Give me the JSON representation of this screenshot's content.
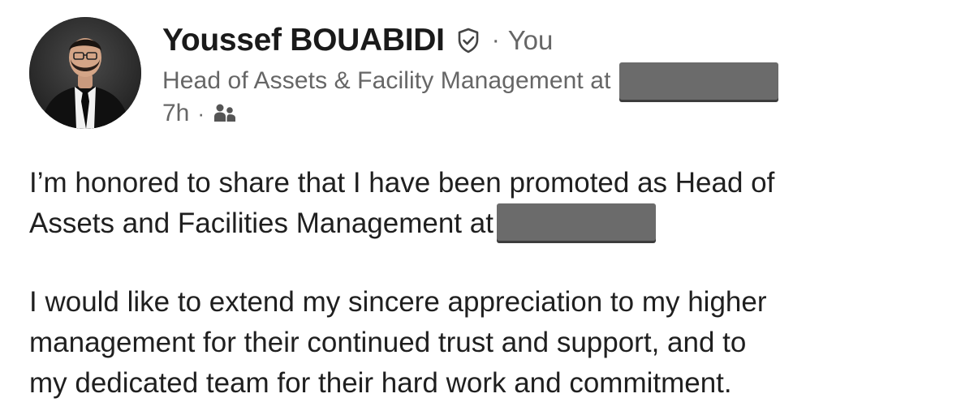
{
  "post": {
    "author": {
      "name": "Youssef BOUABIDI",
      "relation": "You",
      "headline": "Head of Assets & Facility Management at",
      "time": "7h",
      "icons": {
        "verified": "verified-shield-icon",
        "audience": "connections-audience-icon"
      }
    },
    "body": {
      "paragraph1": {
        "line1": "I’m honored to share that I have been promoted as Head of",
        "line2": "Assets and Facilities Management at"
      },
      "paragraph2": {
        "line1": "I would like to extend my sincere appreciation to my higher",
        "line2": "management for their continued trust and support, and to",
        "line3": "my dedicated team for their hard work and commitment."
      }
    }
  }
}
